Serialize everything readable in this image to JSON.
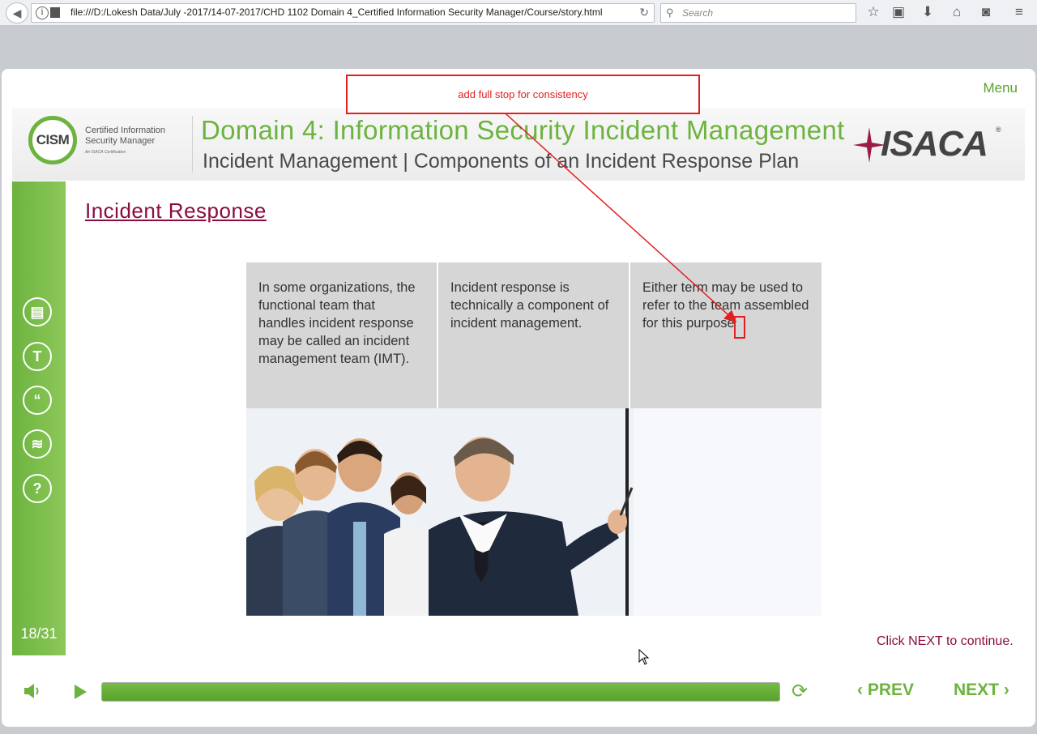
{
  "browser": {
    "url": "file:///D:/Lokesh Data/July -2017/14-07-2017/CHD 1102 Domain 4_Certified Information Security Manager/Course/story.html",
    "search_placeholder": "Search",
    "info_glyph": "i"
  },
  "player": {
    "menu_label": "Menu",
    "banner": {
      "title": "Domain 4: Information Security Incident Management",
      "subtitle": "Incident Management | Components of an Incident Response Plan",
      "cism_logo_text": "CISM",
      "cism_logo_caption": "Certified Information\nSecurity Manager",
      "cism_logo_tagline": "An ISACA Certification",
      "isaca_logo_text": "ISACA",
      "isaca_logo_registered": "®"
    },
    "sidebar": {
      "icons": [
        {
          "name": "notes-icon",
          "glyph": "▤"
        },
        {
          "name": "transcript-icon",
          "glyph": "T"
        },
        {
          "name": "quote-icon",
          "glyph": "“"
        },
        {
          "name": "layers-icon",
          "glyph": "≋"
        },
        {
          "name": "help-icon",
          "glyph": "?"
        }
      ],
      "slide_counter": "18/31"
    },
    "content": {
      "title": "Incident Response",
      "cards": [
        "In some organizations, the functional team that handles incident response may be called an incident management team (IMT).",
        "Incident response is technically a component of incident management.",
        "Either term may be used to refer to the team assembled for this purpose"
      ],
      "instruction": "Click NEXT to continue."
    },
    "controls": {
      "progress_fraction": 1.0,
      "prev_label": "PREV",
      "next_label": "NEXT",
      "prev_glyph": "‹",
      "next_glyph": "›",
      "replay_glyph": "⟳"
    }
  },
  "annotation": {
    "text": "add full stop for consistency",
    "color": "#e02020"
  },
  "colors": {
    "brand_green": "#6db33f",
    "title_maroon": "#8a0d40"
  }
}
